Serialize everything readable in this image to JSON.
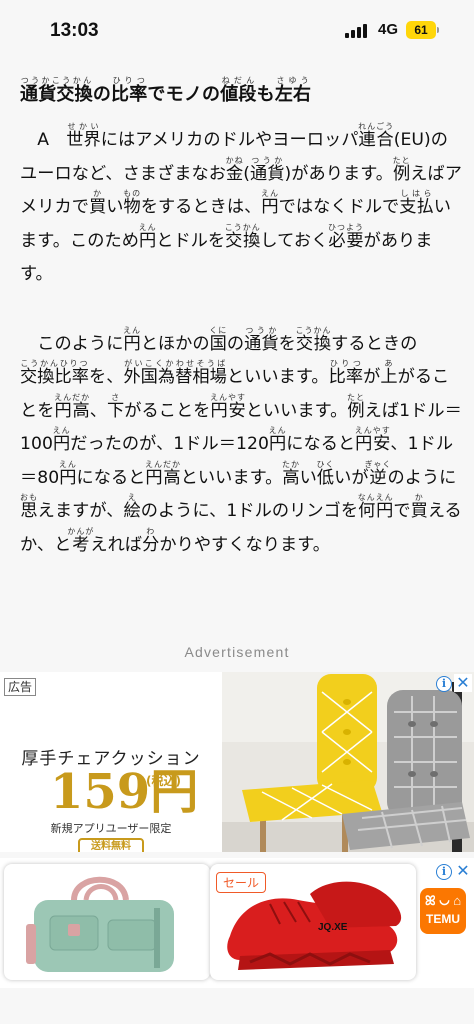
{
  "status_bar": {
    "time": "13:03",
    "network": "4G",
    "battery": "61"
  },
  "article": {
    "title_segments": [
      {
        "base": "通貨交換",
        "ruby": "つうかこうかん"
      },
      {
        "text": "の"
      },
      {
        "base": "比率",
        "ruby": "ひりつ"
      },
      {
        "text": "でモノの"
      },
      {
        "base": "値段",
        "ruby": "ねだん"
      },
      {
        "text": "も"
      },
      {
        "base": "左右",
        "ruby": "さゆう"
      }
    ],
    "para1_segments": [
      {
        "text": "　A　"
      },
      {
        "base": "世界",
        "ruby": "せかい"
      },
      {
        "text": "にはアメリカのドルやヨーロッパ"
      },
      {
        "base": "連合",
        "ruby": "れんごう"
      },
      {
        "text": "(EU)のユーロなど、さまざまなお"
      },
      {
        "base": "金",
        "ruby": "かね"
      },
      {
        "text": "("
      },
      {
        "base": "通貨",
        "ruby": "つうか"
      },
      {
        "text": ")があります。"
      },
      {
        "base": "例",
        "ruby": "たと"
      },
      {
        "text": "えばアメリカで"
      },
      {
        "base": "買",
        "ruby": "か"
      },
      {
        "text": "い"
      },
      {
        "base": "物",
        "ruby": "もの"
      },
      {
        "text": "をするときは、"
      },
      {
        "base": "円",
        "ruby": "えん"
      },
      {
        "text": "ではなくドルで"
      },
      {
        "base": "支払",
        "ruby": "しはら"
      },
      {
        "text": "います。このため"
      },
      {
        "base": "円",
        "ruby": "えん"
      },
      {
        "text": "とドルを"
      },
      {
        "base": "交換",
        "ruby": "こうかん"
      },
      {
        "text": "しておく"
      },
      {
        "base": "必要",
        "ruby": "ひつよう"
      },
      {
        "text": "があります。"
      }
    ],
    "para2_segments": [
      {
        "text": "　このように"
      },
      {
        "base": "円",
        "ruby": "えん"
      },
      {
        "text": "とほかの"
      },
      {
        "base": "国",
        "ruby": "くに"
      },
      {
        "text": "の"
      },
      {
        "base": "通貨",
        "ruby": "つうか"
      },
      {
        "text": "を"
      },
      {
        "base": "交換",
        "ruby": "こうかん"
      },
      {
        "text": "するときの"
      },
      {
        "base": "交換比率",
        "ruby": "こうかんひりつ"
      },
      {
        "text": "を、"
      },
      {
        "base": "外国為替相場",
        "ruby": "がいこくかわせそうば"
      },
      {
        "text": "といいます。"
      },
      {
        "base": "比率",
        "ruby": "ひりつ"
      },
      {
        "text": "が"
      },
      {
        "base": "上",
        "ruby": "あ"
      },
      {
        "text": "がることを"
      },
      {
        "base": "円高",
        "ruby": "えんだか"
      },
      {
        "text": "、"
      },
      {
        "base": "下",
        "ruby": "さ"
      },
      {
        "text": "がることを"
      },
      {
        "base": "円安",
        "ruby": "えんやす"
      },
      {
        "text": "といいます。"
      },
      {
        "base": "例",
        "ruby": "たと"
      },
      {
        "text": "えば1ドル＝100"
      },
      {
        "base": "円",
        "ruby": "えん"
      },
      {
        "text": "だったのが、1ドル＝120"
      },
      {
        "base": "円",
        "ruby": "えん"
      },
      {
        "text": "になると"
      },
      {
        "base": "円安",
        "ruby": "えんやす"
      },
      {
        "text": "、1ドル＝80"
      },
      {
        "base": "円",
        "ruby": "えん"
      },
      {
        "text": "になると"
      },
      {
        "base": "円高",
        "ruby": "えんだか"
      },
      {
        "text": "といいます。"
      },
      {
        "base": "高",
        "ruby": "たか"
      },
      {
        "text": "い"
      },
      {
        "base": "低",
        "ruby": "ひく"
      },
      {
        "text": "いが"
      },
      {
        "base": "逆",
        "ruby": "ぎゃく"
      },
      {
        "text": "のように"
      },
      {
        "base": "思",
        "ruby": "おも"
      },
      {
        "text": "えますが、"
      },
      {
        "base": "絵",
        "ruby": "え"
      },
      {
        "text": "のように、1ドルのリンゴを"
      },
      {
        "base": "何円",
        "ruby": "なんえん"
      },
      {
        "text": "で"
      },
      {
        "base": "買",
        "ruby": "か"
      },
      {
        "text": "えるか、と"
      },
      {
        "base": "考",
        "ruby": "かんが"
      },
      {
        "text": "えれば"
      },
      {
        "base": "分",
        "ruby": "わ"
      },
      {
        "text": "かりやすくなります。"
      }
    ]
  },
  "ad_label": "Advertisement",
  "ad_banner": {
    "badge": "広告",
    "product_name": "厚手チェアクッション",
    "price": "159円",
    "tax_note": "(税込)",
    "note": "新規アプリユーザー限定",
    "shipping": "送料無料",
    "info_icon": "i",
    "close_icon": "✕",
    "colors": {
      "price": "#c89a1c",
      "cushion_yellow": "#f2cf1d",
      "cushion_gray": "#9a9a9a"
    }
  },
  "ad_products": {
    "sale_badge": "セール",
    "brand": "TEMU",
    "brand_glyphs": "ꕤ ◡ ⌂",
    "shoe_text": "JQ.XE",
    "info_icon": "i",
    "close_icon": "✕",
    "colors": {
      "temu": "#fb7701",
      "bag": "#9cc7b5",
      "shoe": "#d91e1e"
    }
  }
}
